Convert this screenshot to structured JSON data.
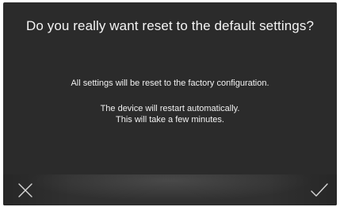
{
  "dialog": {
    "title": "Do you really want reset to the default settings?",
    "line1": "All settings will be reset to the factory configuration.",
    "line2": "The device will restart automatically.",
    "line3": "This will take a few minutes."
  },
  "actions": {
    "cancel_icon": "close-icon",
    "confirm_icon": "check-icon"
  },
  "colors": {
    "background": "#2b2b2b",
    "footer": "#232323",
    "text": "#ffffff"
  }
}
